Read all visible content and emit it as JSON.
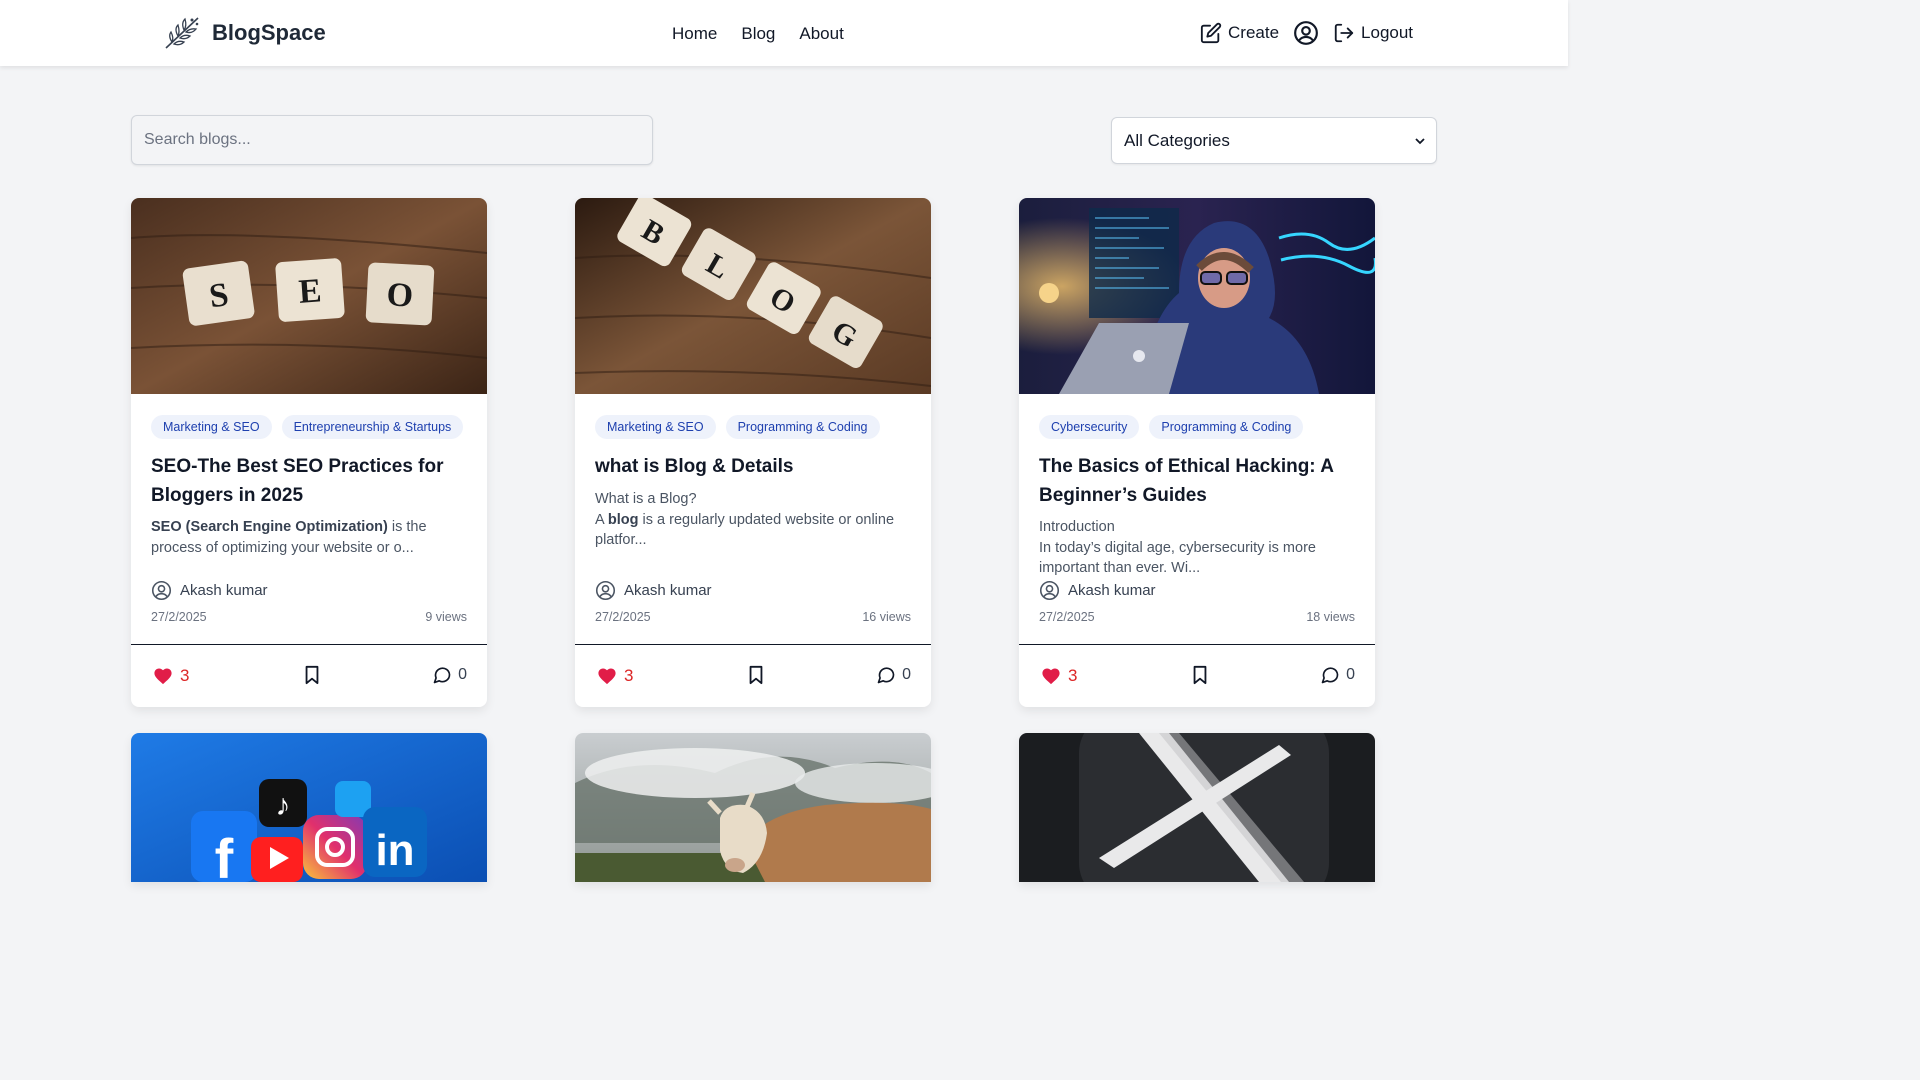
{
  "header": {
    "logo_text": "BlogSpace",
    "logo_icon": "quill-branch-icon",
    "nav": [
      "Home",
      "Blog",
      "About"
    ],
    "create_label": "Create",
    "logout_label": "Logout"
  },
  "filters": {
    "search_placeholder": "Search blogs...",
    "category_selected": "All Categories"
  },
  "colors": {
    "tag_bg": "#eef2fb",
    "tag_text": "#1e40af",
    "like": "#dc2626",
    "page_bg": "#f3f4f6"
  },
  "posts": [
    {
      "image": "seo-scrabble-tiles",
      "tags": [
        "Marketing & SEO",
        "Entrepreneurship & Startups"
      ],
      "title": "SEO-The Best SEO Practices for Bloggers in 2025",
      "excerpt_bold": "SEO (Search Engine Optimization)",
      "excerpt_rest": " is the process of optimizing your website or o...",
      "author": "Akash kumar",
      "date": "27/2/2025",
      "views": "9 views",
      "likes": "3",
      "comments": "0"
    },
    {
      "image": "blog-scrabble-tiles",
      "tags": [
        "Marketing & SEO",
        "Programming & Coding"
      ],
      "title": "what is Blog & Details",
      "excerpt_line1": "What is a Blog?",
      "excerpt_pre": "A ",
      "excerpt_bold": "blog",
      "excerpt_rest": " is a regularly updated website or online platfor...",
      "author": "Akash kumar",
      "date": "27/2/2025",
      "views": "16 views",
      "likes": "3",
      "comments": "0"
    },
    {
      "image": "hacker-hoodie-laptop",
      "tags": [
        "Cybersecurity",
        "Programming & Coding"
      ],
      "title": "The Basics of Ethical Hacking: A Beginner’s Guides",
      "excerpt_line1": "Introduction",
      "excerpt_rest": "In today’s digital age, cybersecurity is more important than ever. Wi...",
      "author": "Akash kumar",
      "date": "27/2/2025",
      "views": "18 views",
      "likes": "3",
      "comments": "0"
    },
    {
      "image": "social-media-icons"
    },
    {
      "image": "cow-mountain-clouds"
    },
    {
      "image": "x-logo-dark"
    }
  ]
}
